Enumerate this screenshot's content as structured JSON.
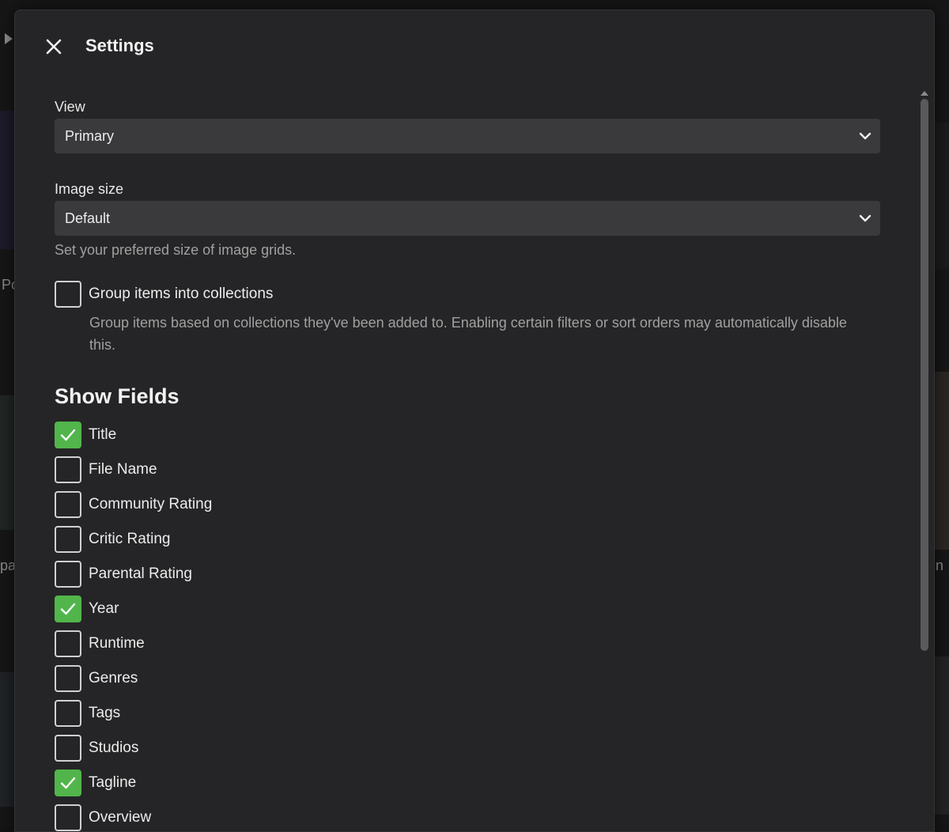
{
  "dialog": {
    "title": "Settings"
  },
  "view": {
    "label": "View",
    "selected": "Primary"
  },
  "image_size": {
    "label": "Image size",
    "selected": "Default",
    "help": "Set your preferred size of image grids."
  },
  "group_collections": {
    "label": "Group items into collections",
    "checked": false,
    "description": "Group items based on collections they've been added to. Enabling certain filters or sort orders may automatically disable this."
  },
  "show_fields": {
    "title": "Show Fields",
    "items": [
      {
        "label": "Title",
        "checked": true
      },
      {
        "label": "File Name",
        "checked": false
      },
      {
        "label": "Community Rating",
        "checked": false
      },
      {
        "label": "Critic Rating",
        "checked": false
      },
      {
        "label": "Parental Rating",
        "checked": false
      },
      {
        "label": "Year",
        "checked": true
      },
      {
        "label": "Runtime",
        "checked": false
      },
      {
        "label": "Genres",
        "checked": false
      },
      {
        "label": "Tags",
        "checked": false
      },
      {
        "label": "Studios",
        "checked": false
      },
      {
        "label": "Tagline",
        "checked": true
      },
      {
        "label": "Overview",
        "checked": false
      }
    ]
  },
  "background": {
    "fragments": [
      "Po",
      "pa",
      "n"
    ]
  },
  "colors": {
    "accent": "#52b54b",
    "dialog_bg": "#252527",
    "select_bg": "#3a3a3d"
  }
}
